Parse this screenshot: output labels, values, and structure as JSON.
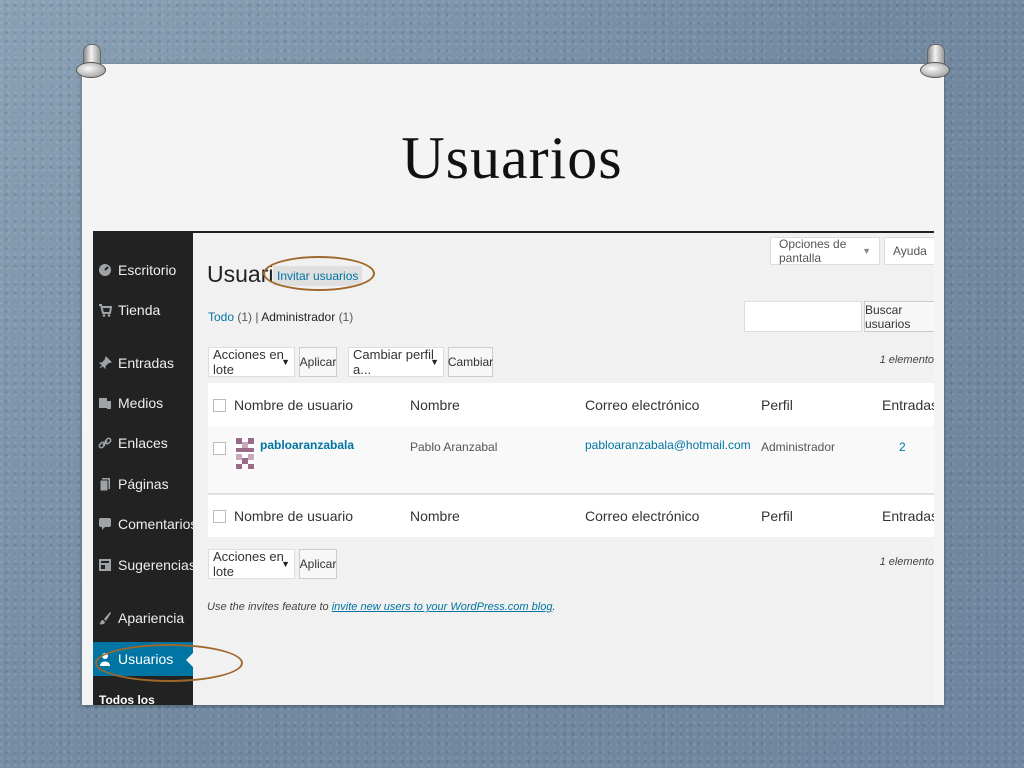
{
  "slide": {
    "title": "Usuarios"
  },
  "sidebar": {
    "items": [
      {
        "label": "Escritorio",
        "icon": "dashboard-icon"
      },
      {
        "label": "Tienda",
        "icon": "cart-icon"
      },
      {
        "label": "Entradas",
        "icon": "pushpin-icon"
      },
      {
        "label": "Medios",
        "icon": "media-icon"
      },
      {
        "label": "Enlaces",
        "icon": "link-icon"
      },
      {
        "label": "Páginas",
        "icon": "pages-icon"
      },
      {
        "label": "Comentarios",
        "icon": "comment-icon"
      },
      {
        "label": "Sugerencias",
        "icon": "feedback-icon"
      },
      {
        "label": "Apariencia",
        "icon": "brush-icon"
      },
      {
        "label": "Usuarios",
        "icon": "user-icon",
        "active": true
      }
    ],
    "sub_item": "Todos los usuarios"
  },
  "header": {
    "screen_options": "Opciones de pantalla",
    "help": "Ayuda"
  },
  "page": {
    "title": "Usuarios",
    "add_new": "Invitar usuarios"
  },
  "filters": {
    "all_label": "Todo",
    "all_count": "(1)",
    "sep": "|",
    "admin_label": "Administrador",
    "admin_count": "(1)"
  },
  "search": {
    "button": "Buscar usuarios"
  },
  "bulk": {
    "actions": "Acciones en lote",
    "apply": "Aplicar",
    "change_role": "Cambiar perfil a...",
    "change": "Cambiar",
    "count": "1 elemento"
  },
  "table": {
    "columns": [
      "Nombre de usuario",
      "Nombre",
      "Correo electrónico",
      "Perfil",
      "Entradas"
    ],
    "rows": [
      {
        "username": "pabloaranzabala",
        "name": "Pablo Aranzabal",
        "email": "pabloaranzabala@hotmail.com",
        "role": "Administrador",
        "posts": "2"
      }
    ]
  },
  "invite_note": {
    "prefix": "Use the invites feature to ",
    "link": "invite new users to your WordPress.com blog",
    "suffix": "."
  },
  "colors": {
    "accent": "#0074a2",
    "sidebar_bg": "#222222",
    "highlight_ring": "#a0672b"
  }
}
